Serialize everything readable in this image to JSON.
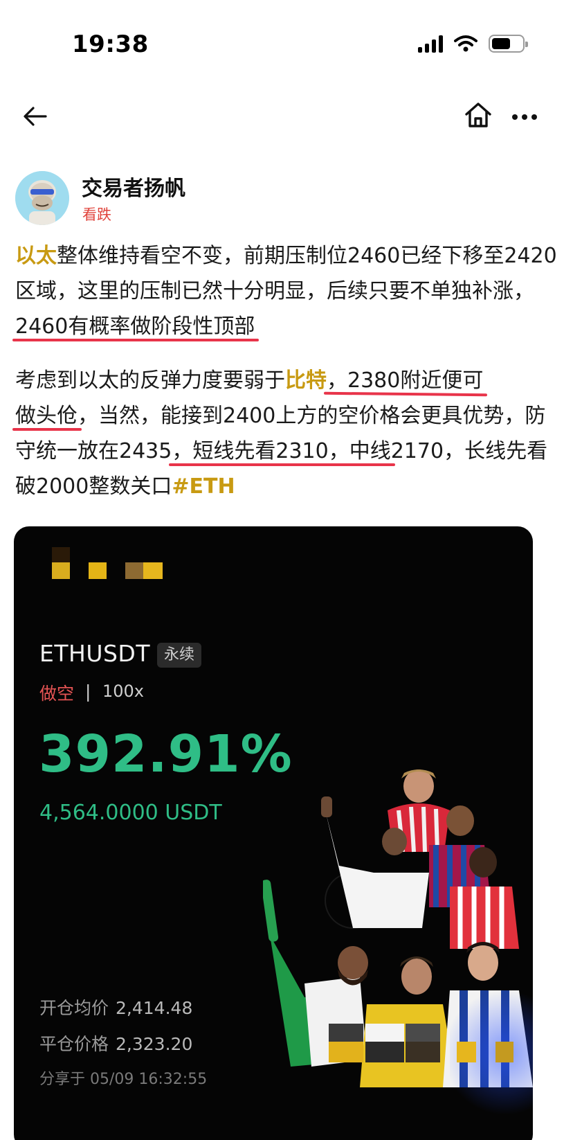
{
  "status_bar": {
    "time": "19:38"
  },
  "author": {
    "name": "交易者扬帆",
    "tag": "看跌"
  },
  "post": {
    "p1": {
      "highlight": "以太",
      "text_a": "整体维持看空不变，前期压制位2460已经下移至2420区域，这里的压制已然十分明显，后续只要不单独补涨，",
      "underlined": "2460有概率做阶段性顶部"
    },
    "p2": {
      "text_a": "考虑到以太的反弹力度要弱于",
      "highlight": "比特",
      "underlined_1": "，2380附近便可",
      "underlined_2": "做头伧",
      "text_b": "，当然，能接到2400上方的空价格会更具优势，防守统一放在2435",
      "underlined_3": "，短线先看2310，中线",
      "text_c": "2170，长线先看破2000整数关口",
      "hashtag": "#ETH"
    }
  },
  "card": {
    "symbol": "ETHUSDT",
    "badge": "永续",
    "direction": "做空",
    "separator": "|",
    "leverage": "100x",
    "pnl_percent": "392.91%",
    "pnl_usdt": "4,564.0000 USDT",
    "open_label": "开仓均价",
    "open_price": "2,414.48",
    "close_label": "平仓价格",
    "close_price": "2,323.20",
    "shared_at": "分享于 05/09 16:32:55"
  },
  "colors": {
    "accent_gold": "#c89a12",
    "underline_red": "#e8344a",
    "profit_green": "#2fbd86",
    "short_red": "#e65454",
    "tag_red": "#e0443c"
  }
}
